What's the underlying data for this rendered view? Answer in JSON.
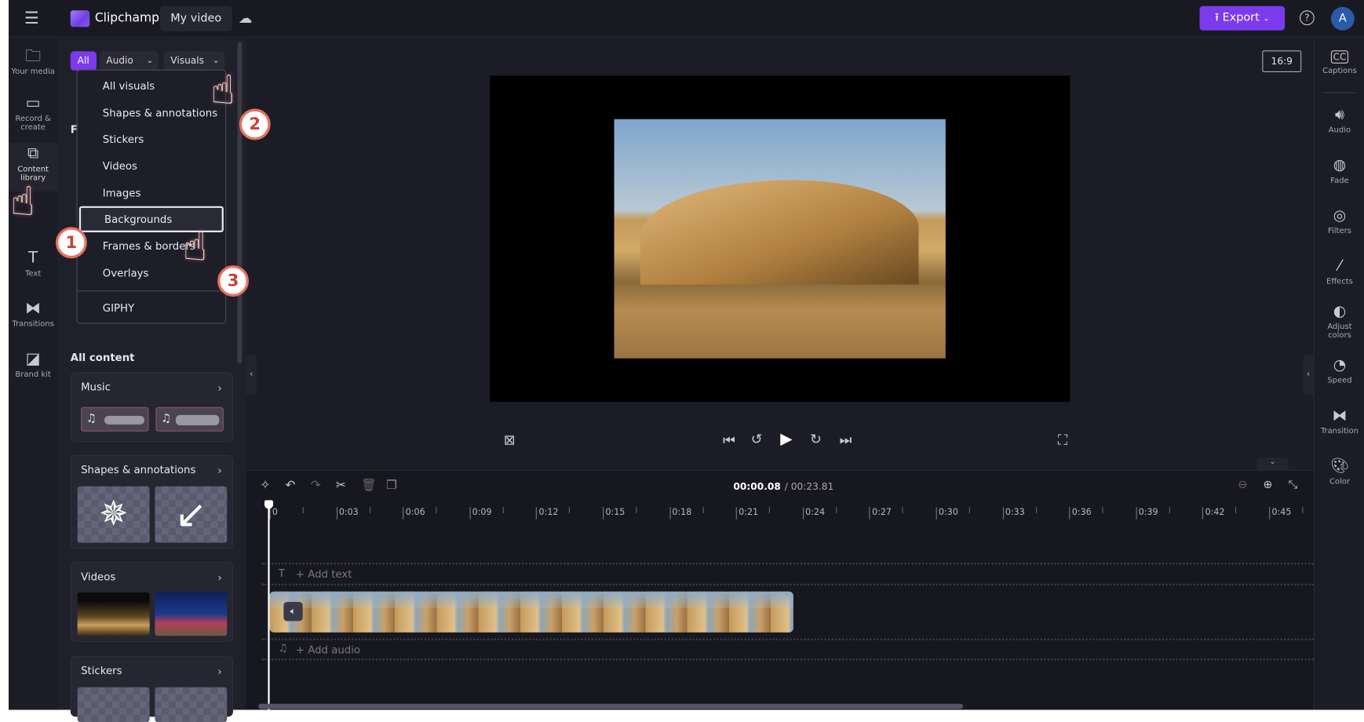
{
  "topbar": {
    "app_name": "Clipchamp",
    "project_title": "My video",
    "export_label": "Export",
    "avatar_initial": "A",
    "accent": "#7c3aed"
  },
  "left_rail": [
    {
      "label": "Your media",
      "icon": "folder-icon"
    },
    {
      "label": "Record & create",
      "icon": "camera-icon"
    },
    {
      "label": "Content library",
      "icon": "content-library-icon"
    },
    {
      "label": "Text",
      "icon": "text-icon"
    },
    {
      "label": "Transitions",
      "icon": "transitions-icon"
    },
    {
      "label": "Brand kit",
      "icon": "brand-kit-icon"
    }
  ],
  "filters": {
    "all": "All",
    "audio": "Audio",
    "visuals": "Visuals"
  },
  "visuals_menu": {
    "items": [
      "All visuals",
      "Shapes & annotations",
      "Stickers",
      "Videos",
      "Images",
      "Backgrounds",
      "Frames & borders",
      "Overlays",
      "GIPHY"
    ],
    "highlighted": "Backgrounds"
  },
  "hidden_heading_initial": "F",
  "content": {
    "heading": "All content",
    "cards": [
      {
        "title": "Music"
      },
      {
        "title": "Shapes & annotations"
      },
      {
        "title": "Videos"
      },
      {
        "title": "Stickers"
      }
    ]
  },
  "preview": {
    "aspect_ratio": "16:9"
  },
  "right_rail": [
    {
      "label": "Captions",
      "icon": "captions-icon"
    },
    {
      "label": "Audio",
      "icon": "speaker-icon"
    },
    {
      "label": "Fade",
      "icon": "fade-icon"
    },
    {
      "label": "Filters",
      "icon": "filters-icon"
    },
    {
      "label": "Effects",
      "icon": "magic-wand-icon"
    },
    {
      "label": "Adjust colors",
      "icon": "adjust-colors-icon"
    },
    {
      "label": "Speed",
      "icon": "speedometer-icon"
    },
    {
      "label": "Transition",
      "icon": "transition-icon"
    },
    {
      "label": "Color",
      "icon": "palette-icon"
    }
  ],
  "timeline": {
    "current_time": "00:00.08",
    "total_time": "/ 00:23.81",
    "ticks": [
      "0",
      "0:03",
      "0:06",
      "0:09",
      "0:12",
      "0:15",
      "0:18",
      "0:21",
      "0:24",
      "0:27",
      "0:30",
      "0:33",
      "0:36",
      "0:39",
      "0:42",
      "0:45"
    ],
    "add_text": "+ Add text",
    "add_audio": "+ Add audio"
  },
  "annotations": [
    "1",
    "2",
    "3"
  ]
}
